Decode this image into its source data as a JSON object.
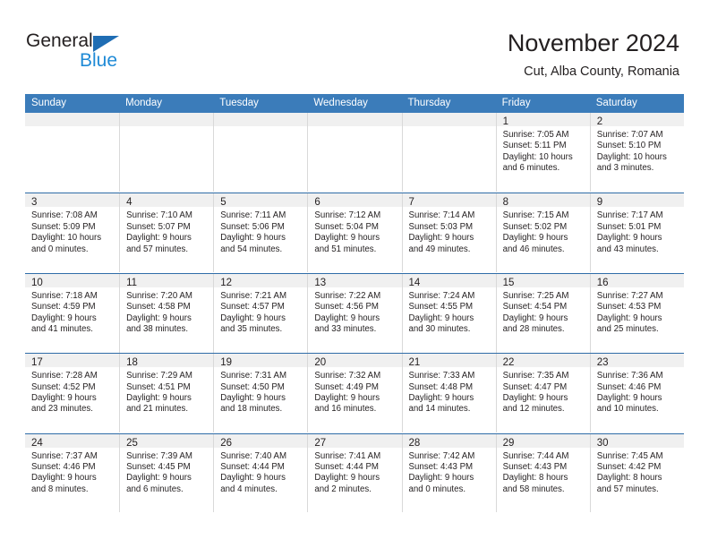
{
  "brand": {
    "name_top": "General",
    "name_bottom": "Blue",
    "triangle_color": "#1f6db4",
    "blue_text_color": "#1f8ad6"
  },
  "header": {
    "title": "November 2024",
    "subtitle": "Cut, Alba County, Romania"
  },
  "theme": {
    "header_row_bg": "#3b7cba",
    "header_row_text": "#ffffff",
    "week_divider": "#2f6da8",
    "date_band_bg": "#f0f0f0",
    "cell_divider": "#d9d9d9",
    "text": "#231f20"
  },
  "calendar": {
    "weekday_headers": [
      "Sunday",
      "Monday",
      "Tuesday",
      "Wednesday",
      "Thursday",
      "Friday",
      "Saturday"
    ],
    "weeks": [
      [
        {
          "day": "",
          "sunrise": "",
          "sunset": "",
          "daylight_line1": "",
          "daylight_line2": ""
        },
        {
          "day": "",
          "sunrise": "",
          "sunset": "",
          "daylight_line1": "",
          "daylight_line2": ""
        },
        {
          "day": "",
          "sunrise": "",
          "sunset": "",
          "daylight_line1": "",
          "daylight_line2": ""
        },
        {
          "day": "",
          "sunrise": "",
          "sunset": "",
          "daylight_line1": "",
          "daylight_line2": ""
        },
        {
          "day": "",
          "sunrise": "",
          "sunset": "",
          "daylight_line1": "",
          "daylight_line2": ""
        },
        {
          "day": "1",
          "sunrise": "Sunrise: 7:05 AM",
          "sunset": "Sunset: 5:11 PM",
          "daylight_line1": "Daylight: 10 hours",
          "daylight_line2": "and 6 minutes."
        },
        {
          "day": "2",
          "sunrise": "Sunrise: 7:07 AM",
          "sunset": "Sunset: 5:10 PM",
          "daylight_line1": "Daylight: 10 hours",
          "daylight_line2": "and 3 minutes."
        }
      ],
      [
        {
          "day": "3",
          "sunrise": "Sunrise: 7:08 AM",
          "sunset": "Sunset: 5:09 PM",
          "daylight_line1": "Daylight: 10 hours",
          "daylight_line2": "and 0 minutes."
        },
        {
          "day": "4",
          "sunrise": "Sunrise: 7:10 AM",
          "sunset": "Sunset: 5:07 PM",
          "daylight_line1": "Daylight: 9 hours",
          "daylight_line2": "and 57 minutes."
        },
        {
          "day": "5",
          "sunrise": "Sunrise: 7:11 AM",
          "sunset": "Sunset: 5:06 PM",
          "daylight_line1": "Daylight: 9 hours",
          "daylight_line2": "and 54 minutes."
        },
        {
          "day": "6",
          "sunrise": "Sunrise: 7:12 AM",
          "sunset": "Sunset: 5:04 PM",
          "daylight_line1": "Daylight: 9 hours",
          "daylight_line2": "and 51 minutes."
        },
        {
          "day": "7",
          "sunrise": "Sunrise: 7:14 AM",
          "sunset": "Sunset: 5:03 PM",
          "daylight_line1": "Daylight: 9 hours",
          "daylight_line2": "and 49 minutes."
        },
        {
          "day": "8",
          "sunrise": "Sunrise: 7:15 AM",
          "sunset": "Sunset: 5:02 PM",
          "daylight_line1": "Daylight: 9 hours",
          "daylight_line2": "and 46 minutes."
        },
        {
          "day": "9",
          "sunrise": "Sunrise: 7:17 AM",
          "sunset": "Sunset: 5:01 PM",
          "daylight_line1": "Daylight: 9 hours",
          "daylight_line2": "and 43 minutes."
        }
      ],
      [
        {
          "day": "10",
          "sunrise": "Sunrise: 7:18 AM",
          "sunset": "Sunset: 4:59 PM",
          "daylight_line1": "Daylight: 9 hours",
          "daylight_line2": "and 41 minutes."
        },
        {
          "day": "11",
          "sunrise": "Sunrise: 7:20 AM",
          "sunset": "Sunset: 4:58 PM",
          "daylight_line1": "Daylight: 9 hours",
          "daylight_line2": "and 38 minutes."
        },
        {
          "day": "12",
          "sunrise": "Sunrise: 7:21 AM",
          "sunset": "Sunset: 4:57 PM",
          "daylight_line1": "Daylight: 9 hours",
          "daylight_line2": "and 35 minutes."
        },
        {
          "day": "13",
          "sunrise": "Sunrise: 7:22 AM",
          "sunset": "Sunset: 4:56 PM",
          "daylight_line1": "Daylight: 9 hours",
          "daylight_line2": "and 33 minutes."
        },
        {
          "day": "14",
          "sunrise": "Sunrise: 7:24 AM",
          "sunset": "Sunset: 4:55 PM",
          "daylight_line1": "Daylight: 9 hours",
          "daylight_line2": "and 30 minutes."
        },
        {
          "day": "15",
          "sunrise": "Sunrise: 7:25 AM",
          "sunset": "Sunset: 4:54 PM",
          "daylight_line1": "Daylight: 9 hours",
          "daylight_line2": "and 28 minutes."
        },
        {
          "day": "16",
          "sunrise": "Sunrise: 7:27 AM",
          "sunset": "Sunset: 4:53 PM",
          "daylight_line1": "Daylight: 9 hours",
          "daylight_line2": "and 25 minutes."
        }
      ],
      [
        {
          "day": "17",
          "sunrise": "Sunrise: 7:28 AM",
          "sunset": "Sunset: 4:52 PM",
          "daylight_line1": "Daylight: 9 hours",
          "daylight_line2": "and 23 minutes."
        },
        {
          "day": "18",
          "sunrise": "Sunrise: 7:29 AM",
          "sunset": "Sunset: 4:51 PM",
          "daylight_line1": "Daylight: 9 hours",
          "daylight_line2": "and 21 minutes."
        },
        {
          "day": "19",
          "sunrise": "Sunrise: 7:31 AM",
          "sunset": "Sunset: 4:50 PM",
          "daylight_line1": "Daylight: 9 hours",
          "daylight_line2": "and 18 minutes."
        },
        {
          "day": "20",
          "sunrise": "Sunrise: 7:32 AM",
          "sunset": "Sunset: 4:49 PM",
          "daylight_line1": "Daylight: 9 hours",
          "daylight_line2": "and 16 minutes."
        },
        {
          "day": "21",
          "sunrise": "Sunrise: 7:33 AM",
          "sunset": "Sunset: 4:48 PM",
          "daylight_line1": "Daylight: 9 hours",
          "daylight_line2": "and 14 minutes."
        },
        {
          "day": "22",
          "sunrise": "Sunrise: 7:35 AM",
          "sunset": "Sunset: 4:47 PM",
          "daylight_line1": "Daylight: 9 hours",
          "daylight_line2": "and 12 minutes."
        },
        {
          "day": "23",
          "sunrise": "Sunrise: 7:36 AM",
          "sunset": "Sunset: 4:46 PM",
          "daylight_line1": "Daylight: 9 hours",
          "daylight_line2": "and 10 minutes."
        }
      ],
      [
        {
          "day": "24",
          "sunrise": "Sunrise: 7:37 AM",
          "sunset": "Sunset: 4:46 PM",
          "daylight_line1": "Daylight: 9 hours",
          "daylight_line2": "and 8 minutes."
        },
        {
          "day": "25",
          "sunrise": "Sunrise: 7:39 AM",
          "sunset": "Sunset: 4:45 PM",
          "daylight_line1": "Daylight: 9 hours",
          "daylight_line2": "and 6 minutes."
        },
        {
          "day": "26",
          "sunrise": "Sunrise: 7:40 AM",
          "sunset": "Sunset: 4:44 PM",
          "daylight_line1": "Daylight: 9 hours",
          "daylight_line2": "and 4 minutes."
        },
        {
          "day": "27",
          "sunrise": "Sunrise: 7:41 AM",
          "sunset": "Sunset: 4:44 PM",
          "daylight_line1": "Daylight: 9 hours",
          "daylight_line2": "and 2 minutes."
        },
        {
          "day": "28",
          "sunrise": "Sunrise: 7:42 AM",
          "sunset": "Sunset: 4:43 PM",
          "daylight_line1": "Daylight: 9 hours",
          "daylight_line2": "and 0 minutes."
        },
        {
          "day": "29",
          "sunrise": "Sunrise: 7:44 AM",
          "sunset": "Sunset: 4:43 PM",
          "daylight_line1": "Daylight: 8 hours",
          "daylight_line2": "and 58 minutes."
        },
        {
          "day": "30",
          "sunrise": "Sunrise: 7:45 AM",
          "sunset": "Sunset: 4:42 PM",
          "daylight_line1": "Daylight: 8 hours",
          "daylight_line2": "and 57 minutes."
        }
      ]
    ]
  }
}
